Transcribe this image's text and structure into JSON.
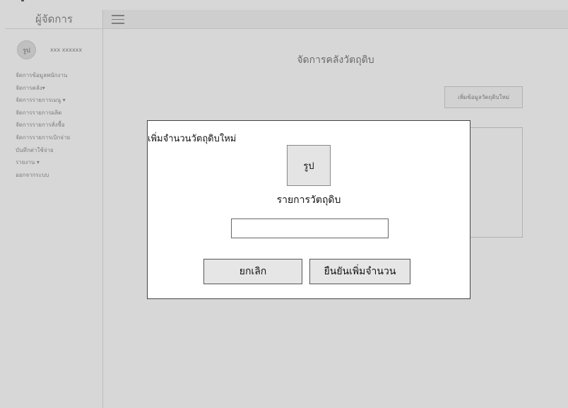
{
  "sidebar": {
    "title": "ผู้จัดการ",
    "avatar_text": "รูป",
    "user_name": "xxx xxxxxx",
    "items": [
      {
        "label": "จัดการข้อมูลพนักงาน"
      },
      {
        "label": "จัดการคลัง▾"
      },
      {
        "label": "จัดการรายการเมนู ▾"
      },
      {
        "label": "จัดการรายการผลิต"
      },
      {
        "label": "จัดการรายการสั่งซื้อ"
      },
      {
        "label": "จัดการรายการเบิกจ่าย"
      },
      {
        "label": "บันทึกค่าใช้จ่าย"
      },
      {
        "label": "รายงาน ▾"
      },
      {
        "label": "ออกจากระบบ"
      }
    ]
  },
  "main": {
    "title": "จัดการคลังวัตถุดิบ",
    "add_button": "เพิ่มข้อมูลวัตถุดิบใหม่"
  },
  "modal": {
    "title": "เพิ่มจำนวนวัตถุดิบใหม่",
    "image_placeholder": "รูป",
    "item_label": "รายการวัตถุดิบ",
    "quantity_value": "",
    "cancel_label": "ยกเลิก",
    "confirm_label": "ยืนยันเพิ่มจำนวน"
  }
}
